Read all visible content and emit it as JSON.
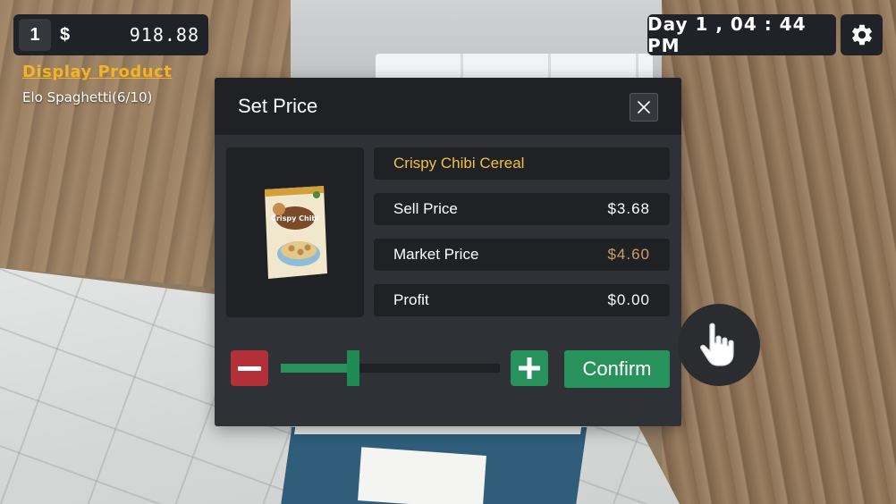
{
  "hud": {
    "level": "1",
    "currency_symbol": "$",
    "money": "918.88",
    "clock": "Day 1 , 04 : 44 PM"
  },
  "objective": {
    "title": "Display Product",
    "detail": "Elo Spaghetti(6/10)"
  },
  "dialog": {
    "title": "Set Price",
    "product_name": "Crispy Chibi Cereal",
    "product_image_text": "Crispy Chibi",
    "sell_price_label": "Sell Price",
    "sell_price": "$3.68",
    "market_price_label": "Market Price",
    "market_price": "$4.60",
    "profit_label": "Profit",
    "profit": "$0.00",
    "confirm_label": "Confirm",
    "slider_fraction": 0.33
  },
  "colors": {
    "accent_green": "#28925c",
    "danger_red": "#b33039",
    "objective_gold": "#f4b322",
    "product_gold": "#f0c040",
    "market_price_tan": "#c9a06a"
  },
  "icons": {
    "settings": "gear-icon",
    "close": "close-icon",
    "decrease": "minus-icon",
    "increase": "plus-icon",
    "interact": "hand-pointer-icon"
  }
}
